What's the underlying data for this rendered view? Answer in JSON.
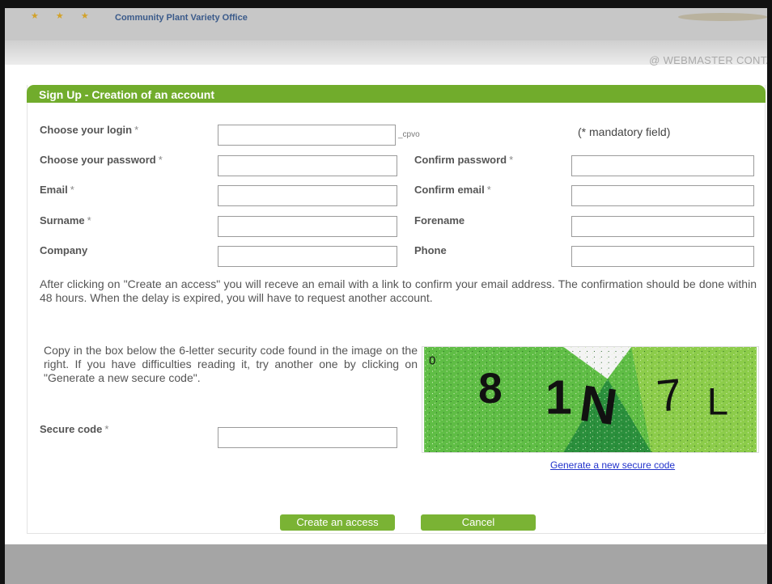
{
  "header": {
    "stars": "★ ★ ★",
    "org_name": "Community Plant Variety Office",
    "webmaster": "@ WEBMASTER CONTA"
  },
  "modal": {
    "title": "Sign Up - Creation of an account",
    "mandatory_note": "(* mandatory field)",
    "login_suffix": "_cpvo",
    "fields": {
      "login": {
        "label": "Choose your login",
        "required": "*",
        "value": ""
      },
      "password": {
        "label": "Choose your password",
        "required": "*",
        "value": ""
      },
      "confirm_password": {
        "label": "Confirm password",
        "required": "*",
        "value": ""
      },
      "email": {
        "label": "Email",
        "required": "*",
        "value": ""
      },
      "confirm_email": {
        "label": "Confirm email",
        "required": "*",
        "value": ""
      },
      "surname": {
        "label": "Surname",
        "required": "*",
        "value": ""
      },
      "forename": {
        "label": "Forename",
        "value": ""
      },
      "company": {
        "label": "Company",
        "value": ""
      },
      "phone": {
        "label": "Phone",
        "value": ""
      },
      "secure_code": {
        "label": "Secure code",
        "required": "*",
        "value": ""
      }
    },
    "info_text": "After clicking on \"Create an access\" you will receve an email with a link to confirm your email address. The confirmation should be done within 48 hours. When the delay is expired, you will have to request another account.",
    "captcha_instructions": "Copy in the box below the 6-letter security code found in the image on the right. If you have difficulties reading it, try another one by clicking on \"Generate a new secure code\".",
    "captcha": {
      "code_chars": [
        "0",
        "8",
        "1",
        "N",
        "7",
        "L"
      ],
      "colors": {
        "light": "#5fbd45",
        "mid": "#8ccc4a",
        "dark": "#2a8f3c",
        "white": "#f4f4f4"
      }
    },
    "generate_link": "Generate a new secure code",
    "buttons": {
      "create": "Create an access",
      "cancel": "Cancel"
    }
  },
  "colors": {
    "accent": "#71ac2c",
    "button": "#7ab334",
    "link": "#2233cc"
  }
}
